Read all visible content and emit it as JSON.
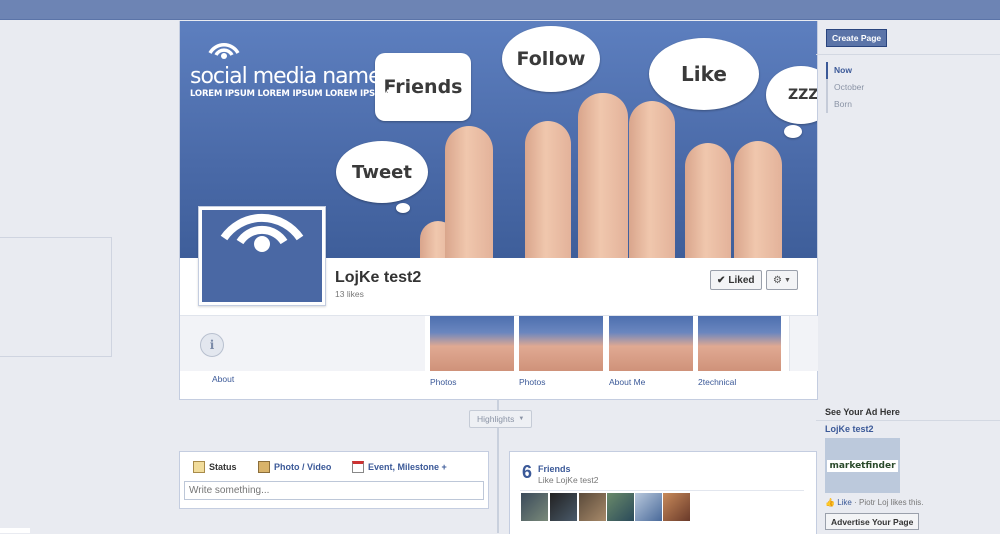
{
  "cover": {
    "brand_name": "social media name",
    "brand_tagline": "LOREM IPSUM LOREM IPSUM LOREM IPSUM",
    "bubbles": [
      "Friends",
      "Follow",
      "Like",
      "Tweet",
      "ZZZ"
    ]
  },
  "page": {
    "name": "LojKe test2",
    "likes": "13 likes",
    "liked_label": "Liked"
  },
  "apps": [
    {
      "label": "About"
    },
    {
      "label": "Photos"
    },
    {
      "label": "Photos"
    },
    {
      "label": "About Me"
    },
    {
      "label": "2technical"
    }
  ],
  "timeline": {
    "highlights_label": "Highlights"
  },
  "composer": {
    "tabs": [
      "Status",
      "Photo / Video",
      "Event, Milestone +"
    ],
    "placeholder": "Write something..."
  },
  "friends": {
    "count": "6",
    "title": "Friends",
    "subtitle": "Like LojKe test2"
  },
  "sidebar": {
    "create_page": "Create Page",
    "years": [
      "Now",
      "October",
      "Born"
    ]
  },
  "ad": {
    "heading": "See Your Ad Here",
    "title": "LojKe test2",
    "image_text": "marketfinder",
    "like_label": "Like",
    "like_text": " · Piotr Loj likes this.",
    "button": "Advertise Your Page"
  },
  "colors": {
    "topbar": "#6d84b4",
    "link": "#3b5998",
    "cover": "#4e6fa8"
  }
}
